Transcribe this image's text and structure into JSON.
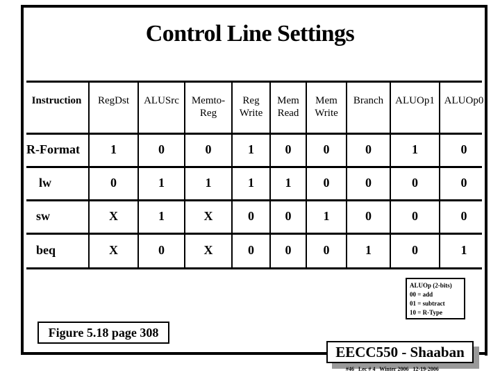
{
  "slide": {
    "title": "Control Line Settings",
    "table": {
      "headers": [
        {
          "line1": "Instruction",
          "line2": ""
        },
        {
          "line1": "RegDst",
          "line2": ""
        },
        {
          "line1": "ALUSrc",
          "line2": ""
        },
        {
          "line1": "Memto-",
          "line2": "Reg"
        },
        {
          "line1": "Reg",
          "line2": "Write"
        },
        {
          "line1": "Mem",
          "line2": "Read"
        },
        {
          "line1": "Mem",
          "line2": "Write"
        },
        {
          "line1": "Branch",
          "line2": ""
        },
        {
          "line1": "ALUOp1",
          "line2": ""
        },
        {
          "line1": "ALUOp0",
          "line2": ""
        }
      ],
      "rows": [
        {
          "instruction": "R-Format",
          "values": [
            "1",
            "0",
            "0",
            "1",
            "0",
            "0",
            "0",
            "1",
            "0"
          ]
        },
        {
          "instruction": "lw",
          "values": [
            "0",
            "1",
            "1",
            "1",
            "1",
            "0",
            "0",
            "0",
            "0"
          ]
        },
        {
          "instruction": "sw",
          "values": [
            "X",
            "1",
            "X",
            "0",
            "0",
            "1",
            "0",
            "0",
            "0"
          ]
        },
        {
          "instruction": "beq",
          "values": [
            "X",
            "0",
            "X",
            "0",
            "0",
            "0",
            "1",
            "0",
            "1"
          ]
        }
      ]
    },
    "legend": {
      "title": "ALUOp (2-bits)",
      "lines": [
        "00 = add",
        "01 = subtract",
        "10 = R-Type"
      ]
    },
    "figure_reference": "Figure 5.18 page 308",
    "badge": "EECC550 - Shaaban",
    "footer": "#46   Lec # 4   Winter 2006   12-19-2006"
  }
}
